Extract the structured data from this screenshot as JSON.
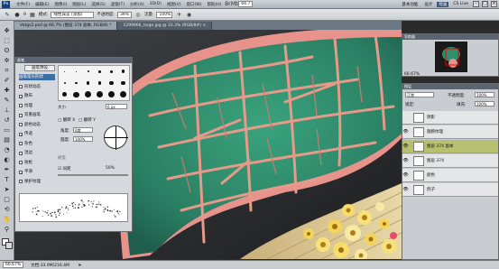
{
  "menubar": {
    "logo": "Ps",
    "items": [
      "文件(F)",
      "编辑(E)",
      "图像(I)",
      "图层(L)",
      "选择(S)",
      "滤镜(T)",
      "分析(A)",
      "3D(D)",
      "视图(V)",
      "窗口(W)",
      "帮助(H)"
    ],
    "zoom": "66.7",
    "workspaces": [
      "基本功能",
      "设计",
      "绘画"
    ],
    "active_workspace": "绘画",
    "cs_live": "CS Live"
  },
  "options": {
    "brush_size": "9",
    "mode_label": "模式:",
    "mode_value": "线性减淡 (添加)",
    "opacity_label": "不透明度:",
    "opacity_value": "39%",
    "flow_label": "流量:",
    "flow_value": "100%"
  },
  "tabs": [
    {
      "label": "Vatgs2.psd @ 66.7% (图层 374 副本, RGB/8) *",
      "active": true
    },
    {
      "label": "1299966_large.jpg @ 33.3% (RGB/8#) ×",
      "active": false
    }
  ],
  "brush_panel": {
    "title": "画笔",
    "preset_button": "画笔预设",
    "options": [
      {
        "label": "画笔笔尖形状",
        "checked": null,
        "selected": true
      },
      {
        "label": "形状动态",
        "checked": false,
        "selected": false
      },
      {
        "label": "散布",
        "checked": true,
        "selected": false
      },
      {
        "label": "纹理",
        "checked": false,
        "selected": false
      },
      {
        "label": "双重画笔",
        "checked": false,
        "selected": false
      },
      {
        "label": "颜色动态",
        "checked": false,
        "selected": false
      },
      {
        "label": "传递",
        "checked": true,
        "selected": false
      },
      {
        "label": "杂色",
        "checked": false,
        "selected": false
      },
      {
        "label": "湿边",
        "checked": false,
        "selected": false
      },
      {
        "label": "喷枪",
        "checked": false,
        "selected": false
      },
      {
        "label": "平滑",
        "checked": true,
        "selected": false
      },
      {
        "label": "保护纹理",
        "checked": false,
        "selected": false
      }
    ],
    "tip_sizes": [
      "1",
      "3",
      "5",
      "9",
      "13",
      "19",
      "5",
      "9",
      "13",
      "17",
      "21",
      "27",
      "35",
      "45",
      "65",
      "100",
      "200",
      "300"
    ],
    "size_label": "大小",
    "size_value": "6 px",
    "flip_x": "翻转 X",
    "flip_y": "翻转 Y",
    "angle_label": "角度:",
    "angle_value": "0度",
    "roundness_label": "圆度:",
    "roundness_value": "100%",
    "hardness_label": "硬度",
    "spacing_label": "间距",
    "spacing_checked": true,
    "spacing_value": "50%"
  },
  "navigator": {
    "title": "导航器",
    "zoom": "66.67%"
  },
  "layers_panel": {
    "title": "图层",
    "blend_mode": "正常",
    "opacity_label": "不透明度:",
    "opacity_value": "100%",
    "lock_label": "锁定:",
    "fill_label": "填充:",
    "fill_value": "100%",
    "layers": [
      {
        "name": "阴影",
        "visible": false,
        "selected": false
      },
      {
        "name": "翅膀纹理",
        "visible": true,
        "selected": false
      },
      {
        "name": "图层 374 副本",
        "visible": true,
        "selected": true
      },
      {
        "name": "图层 374",
        "visible": true,
        "selected": false
      },
      {
        "name": "颜色",
        "visible": true,
        "selected": false
      },
      {
        "name": "鸽子",
        "visible": true,
        "selected": false
      }
    ]
  },
  "status": {
    "zoom": "66.67%",
    "doc": "文档:33.9M/216.4M"
  },
  "colors": {
    "wing_green": "#2e8f6e",
    "vein_pink": "#e89a8a",
    "flower_yellow": "#f2d35b",
    "selected_layer": "#b7c070",
    "active_workspace": "#3c5578"
  }
}
